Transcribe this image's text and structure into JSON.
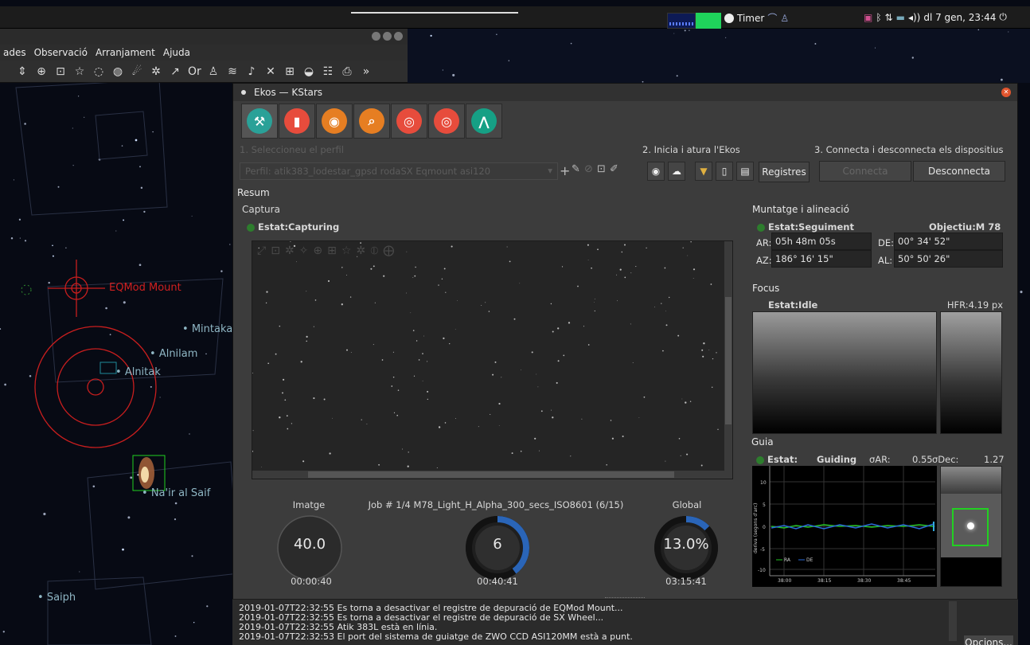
{
  "top_panel": {
    "timer_label": "Timer",
    "clock": "dl 7 gen, 23:44"
  },
  "kstars": {
    "menu": [
      "ades",
      "Observació",
      "Arranjament",
      "Ajuda"
    ],
    "sky_labels": {
      "mount": "EQMod Mount",
      "mintaka": "Mintaka",
      "alnilam": "Alnilam",
      "alnitak": "Alnitak",
      "nair": "Na'ir al Saif",
      "saiph": "Saiph"
    }
  },
  "ekos": {
    "title": "Ekos — KStars",
    "tabs": [
      {
        "name": "setup",
        "color": "#2aa198",
        "glyph": "⚒"
      },
      {
        "name": "scheduler",
        "color": "#e74c3c",
        "glyph": "▮"
      },
      {
        "name": "capture",
        "color": "#e67e22",
        "glyph": "◉"
      },
      {
        "name": "focus",
        "color": "#e67e22",
        "glyph": "⌕"
      },
      {
        "name": "align",
        "color": "#e74c3c",
        "glyph": "◎"
      },
      {
        "name": "guide",
        "color": "#e74c3c",
        "glyph": "◎"
      },
      {
        "name": "mount",
        "color": "#16a085",
        "glyph": "⋀"
      }
    ],
    "step1": "1. Seleccioneu el perfil",
    "profile_label": "Perfil:",
    "profile_value": "atik383_lodestar_gpsd rodaSX Eqmount asi120",
    "step2": "2. Inicia i atura l'Ekos",
    "step3": "3. Connecta i desconnecta els dispositius",
    "logs_btn": "Registres",
    "connect_btn": "Connecta",
    "disconnect_btn": "Desconnecta",
    "summary": "Resum",
    "capture": {
      "title": "Captura",
      "status": "Estat:Capturing",
      "image_label": "Imatge",
      "image_value": "40.0",
      "image_time": "00:00:40",
      "job_label": "Job # 1/4 M78_Light_H_Alpha_300_secs_ISO8601 (6/15)",
      "job_value": "6",
      "job_time": "00:40:41",
      "job_progress": 0.4,
      "global_label": "Global",
      "global_value": "13.0%",
      "global_time": "03:15:41",
      "global_progress": 0.13
    },
    "mount": {
      "title": "Muntatge i alineació",
      "status": "Estat:Seguiment",
      "target": "Objectiu:M 78",
      "ar_label": "AR:",
      "ar_value": "05h 48m 05s",
      "de_label": "DE:",
      "de_value": "00° 34' 52\"",
      "az_label": "AZ:",
      "az_value": "186° 16' 15\"",
      "al_label": "AL:",
      "al_value": "50° 50' 26\""
    },
    "focus": {
      "title": "Focus",
      "status": "Estat:Idle",
      "hfr": "HFR:4.19 px"
    },
    "guide": {
      "title": "Guia",
      "status_label": "Estat:",
      "status_value": "Guiding",
      "sigma_ra_label": "σAR:",
      "sigma_ra_value": "0.55",
      "sigma_de_label": "σDec:",
      "sigma_de_value": "1.27",
      "ylabel": "deriva (segons d'arc)",
      "yticks": [
        "10",
        "5",
        "0",
        "-5",
        "-10"
      ],
      "xticks": [
        "38:00",
        "38:15",
        "38:30",
        "38:45"
      ],
      "legend_ra": "RA",
      "legend_de": "DE"
    },
    "log_lines": [
      "2019-01-07T22:32:55 Es torna a desactivar el registre de depuració de EQMod Mount...",
      "2019-01-07T22:32:55 Es torna a desactivar el registre de depuració de SX Wheel...",
      "2019-01-07T22:32:55 Atik 383L està en línia.",
      "2019-01-07T22:32:53 El port del sistema de guiatge de ZWO CCD ASI120MM està a punt."
    ],
    "options_btn": "Opcions..."
  }
}
